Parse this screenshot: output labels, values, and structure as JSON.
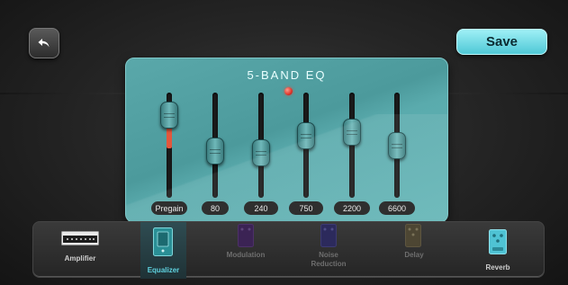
{
  "toolbar": {
    "back_icon": "undo-arrow-icon",
    "save_label": "Save",
    "accent_color": "#5ecbd8"
  },
  "eq": {
    "title": "5-BAND EQ",
    "led_color": "#e0332a",
    "bands": [
      {
        "label": "Pregain",
        "level": 0.88,
        "active_fill": true
      },
      {
        "label": "80",
        "level": 0.42
      },
      {
        "label": "240",
        "level": 0.4
      },
      {
        "label": "750",
        "level": 0.62
      },
      {
        "label": "2200",
        "level": 0.67
      },
      {
        "label": "6600",
        "level": 0.5
      }
    ]
  },
  "pedals": [
    {
      "label": "Amplifier",
      "icon": "amplifier-icon",
      "state": "normal"
    },
    {
      "label": "Equalizer",
      "icon": "equalizer-pedal-icon",
      "state": "selected"
    },
    {
      "label": "Modulation",
      "icon": "modulation-pedal-icon",
      "state": "dim"
    },
    {
      "label": "Noise Reduction",
      "icon": "noise-reduction-pedal-icon",
      "state": "dim"
    },
    {
      "label": "Delay",
      "icon": "delay-pedal-icon",
      "state": "dim"
    },
    {
      "label": "Reverb",
      "icon": "reverb-pedal-icon",
      "state": "normal"
    }
  ]
}
